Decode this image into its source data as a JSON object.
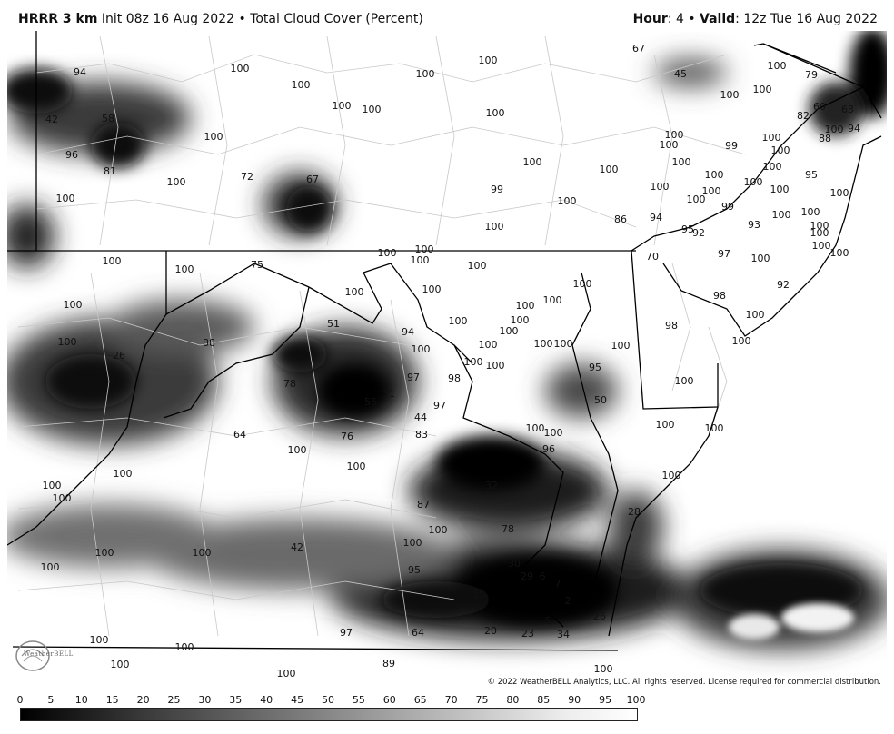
{
  "header": {
    "model": "HRRR 3 km",
    "description": "Init 08z 16 Aug 2022 • Total Cloud Cover (Percent)",
    "hour_label": "Hour",
    "hour_value": ": 4 • ",
    "valid_label": "Valid",
    "valid_value": ": 12z Tue 16 Aug 2022"
  },
  "copyright": "© 2022 WeatherBELL Analytics, LLC. All rights reserved. License required for commercial distribution.",
  "logo_text": "WeatherBELL",
  "colorbar": {
    "ticks": [
      "0",
      "5",
      "10",
      "15",
      "20",
      "25",
      "30",
      "35",
      "40",
      "45",
      "50",
      "55",
      "60",
      "65",
      "70",
      "75",
      "80",
      "85",
      "90",
      "95",
      "100"
    ]
  },
  "colors": {
    "clear": "#ffffff",
    "overcast": "#000000",
    "borders": "#000000",
    "counties": "#c8c8c8"
  },
  "map_labels": [
    [
      "94",
      88,
      79
    ],
    [
      "79",
      54,
      96
    ],
    [
      "42",
      57,
      131
    ],
    [
      "58",
      119,
      130
    ],
    [
      "96",
      79,
      170
    ],
    [
      "81",
      121,
      188
    ],
    [
      "100",
      72,
      218
    ],
    [
      "100",
      264,
      75
    ],
    [
      "100",
      331,
      93
    ],
    [
      "100",
      376,
      116
    ],
    [
      "100",
      409,
      120
    ],
    [
      "100",
      235,
      150
    ],
    [
      "100",
      194,
      200
    ],
    [
      "72",
      272,
      194
    ],
    [
      "67",
      344,
      197
    ],
    [
      "100",
      468,
      81
    ],
    [
      "100",
      537,
      66
    ],
    [
      "67",
      703,
      53
    ],
    [
      "45",
      749,
      81
    ],
    [
      "100",
      545,
      124
    ],
    [
      "100",
      855,
      72
    ],
    [
      "79",
      893,
      82
    ],
    [
      "100",
      803,
      104
    ],
    [
      "100",
      839,
      98
    ],
    [
      "60",
      902,
      117
    ],
    [
      "63",
      933,
      120
    ],
    [
      "82",
      884,
      127
    ],
    [
      "100",
      742,
      148
    ],
    [
      "100",
      736,
      159
    ],
    [
      "99",
      805,
      160
    ],
    [
      "100",
      849,
      151
    ],
    [
      "88",
      908,
      152
    ],
    [
      "100",
      918,
      142
    ],
    [
      "94",
      940,
      141
    ],
    [
      "100",
      859,
      165
    ],
    [
      "100",
      750,
      178
    ],
    [
      "100",
      850,
      183
    ],
    [
      "95",
      893,
      192
    ],
    [
      "100",
      586,
      178
    ],
    [
      "100",
      670,
      186
    ],
    [
      "99",
      547,
      208
    ],
    [
      "100",
      624,
      221
    ],
    [
      "100",
      726,
      205
    ],
    [
      "100",
      786,
      192
    ],
    [
      "100",
      829,
      200
    ],
    [
      "100",
      783,
      210
    ],
    [
      "100",
      766,
      219
    ],
    [
      "100",
      858,
      208
    ],
    [
      "100",
      924,
      212
    ],
    [
      "99",
      801,
      227
    ],
    [
      "100",
      860,
      236
    ],
    [
      "100",
      892,
      233
    ],
    [
      "100",
      902,
      248
    ],
    [
      "93",
      830,
      247
    ],
    [
      "86",
      683,
      241
    ],
    [
      "94",
      722,
      239
    ],
    [
      "95",
      757,
      252
    ],
    [
      "92",
      769,
      256
    ],
    [
      "100",
      544,
      249
    ],
    [
      "100",
      902,
      256
    ],
    [
      "100",
      904,
      270
    ],
    [
      "100",
      924,
      278
    ],
    [
      "100",
      426,
      278
    ],
    [
      "100",
      467,
      274
    ],
    [
      "100",
      462,
      286
    ],
    [
      "100",
      525,
      292
    ],
    [
      "100",
      123,
      287
    ],
    [
      "100",
      203,
      296
    ],
    [
      "75",
      283,
      291
    ],
    [
      "70",
      718,
      282
    ],
    [
      "97",
      797,
      279
    ],
    [
      "100",
      837,
      284
    ],
    [
      "100",
      390,
      321
    ],
    [
      "100",
      475,
      318
    ],
    [
      "100",
      641,
      312
    ],
    [
      "100",
      578,
      336
    ],
    [
      "100",
      608,
      330
    ],
    [
      "92",
      862,
      313
    ],
    [
      "98",
      792,
      325
    ],
    [
      "100",
      80,
      335
    ],
    [
      "51",
      367,
      356
    ],
    [
      "100",
      504,
      353
    ],
    [
      "100",
      572,
      352
    ],
    [
      "100",
      560,
      364
    ],
    [
      "100",
      831,
      346
    ],
    [
      "98",
      739,
      358
    ],
    [
      "88",
      230,
      377
    ],
    [
      "100",
      74,
      376
    ],
    [
      "94",
      449,
      365
    ],
    [
      "100",
      463,
      384
    ],
    [
      "100",
      537,
      379
    ],
    [
      "100",
      598,
      378
    ],
    [
      "100",
      620,
      378
    ],
    [
      "100",
      683,
      380
    ],
    [
      "100",
      816,
      375
    ],
    [
      "26",
      131,
      391
    ],
    [
      "100",
      521,
      398
    ],
    [
      "100",
      545,
      402
    ],
    [
      "95",
      655,
      404
    ],
    [
      "97",
      455,
      415
    ],
    [
      "98",
      500,
      416
    ],
    [
      "78",
      319,
      422
    ],
    [
      "71",
      428,
      433
    ],
    [
      "56",
      408,
      442
    ],
    [
      "50",
      661,
      440
    ],
    [
      "100",
      753,
      419
    ],
    [
      "97",
      484,
      446
    ],
    [
      "44",
      463,
      459
    ],
    [
      "83",
      464,
      478
    ],
    [
      "76",
      382,
      480
    ],
    [
      "64",
      264,
      478
    ],
    [
      "100",
      327,
      495
    ],
    [
      "100",
      732,
      467
    ],
    [
      "100",
      589,
      471
    ],
    [
      "100",
      609,
      476
    ],
    [
      "100",
      786,
      471
    ],
    [
      "96",
      604,
      494
    ],
    [
      "100",
      392,
      513
    ],
    [
      "100",
      135,
      521
    ],
    [
      "100",
      739,
      523
    ],
    [
      "100",
      57,
      534
    ],
    [
      "100",
      68,
      548
    ],
    [
      "32",
      541,
      534
    ],
    [
      "87",
      466,
      555
    ],
    [
      "28",
      698,
      563
    ],
    [
      "100",
      482,
      583
    ],
    [
      "78",
      559,
      582
    ],
    [
      "100",
      454,
      597
    ],
    [
      "100",
      115,
      608
    ],
    [
      "100",
      222,
      608
    ],
    [
      "42",
      327,
      602
    ],
    [
      "100",
      55,
      624
    ],
    [
      "95",
      456,
      627
    ],
    [
      "30",
      566,
      620
    ],
    [
      "29",
      580,
      634
    ],
    [
      "6",
      597,
      634
    ],
    [
      "7",
      614,
      642
    ],
    [
      "15",
      527,
      654
    ],
    [
      "2",
      625,
      661
    ],
    [
      "5",
      603,
      683
    ],
    [
      "26",
      660,
      678
    ],
    [
      "97",
      381,
      696
    ],
    [
      "64",
      460,
      696
    ],
    [
      "20",
      540,
      694
    ],
    [
      "23",
      581,
      697
    ],
    [
      "34",
      620,
      698
    ],
    [
      "100",
      109,
      704
    ],
    [
      "100",
      203,
      712
    ],
    [
      "100",
      132,
      731
    ],
    [
      "89",
      428,
      730
    ],
    [
      "100",
      315,
      741
    ],
    [
      "100",
      664,
      736
    ]
  ]
}
